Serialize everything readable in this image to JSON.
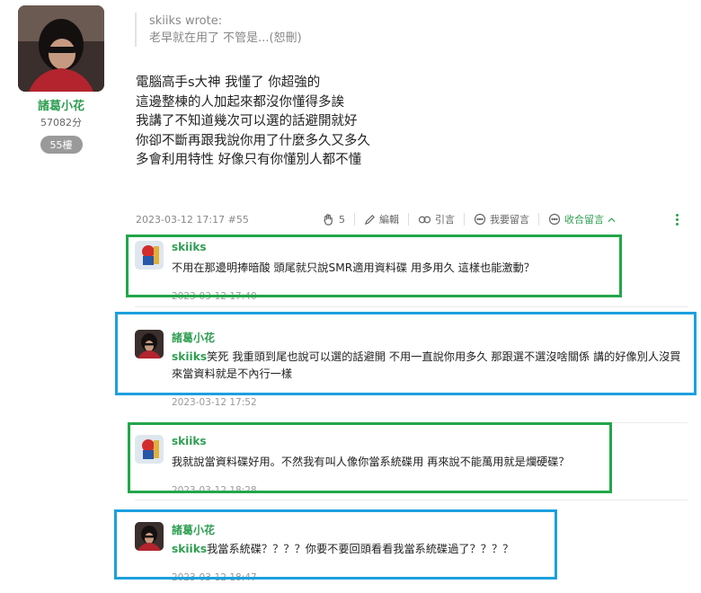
{
  "post": {
    "author": {
      "name": "諸葛小花",
      "points": "57082分",
      "floor": "55樓"
    },
    "quote": {
      "header": "skiiks wrote:",
      "text": "老早就在用了 不管是...(恕刪)"
    },
    "body_lines": [
      "電腦高手s大神 我懂了 你超強的",
      "這邊整棟的人加起來都沒你懂得多誒",
      "我講了不知道幾次可以選的話避開就好",
      "你卻不斷再跟我說你用了什麼多久又多久",
      "多會利用特性 好像只有你懂別人都不懂"
    ],
    "meta": "2023-03-12 17:17 #55",
    "actions": {
      "like_count": "5",
      "edit": "編輯",
      "quote": "引言",
      "reply": "我要留言",
      "collapse": "收合留言"
    }
  },
  "comments": [
    {
      "name": "skiiks",
      "mention": "",
      "text": "不用在那邊明捧暗酸 頭尾就只說SMR適用資料碟 用多用久 這樣也能激動？",
      "time": "2023-03-12 17:40"
    },
    {
      "name": "諸葛小花",
      "mention": "skiiks",
      "text": "笑死 我重頭到尾也說可以選的話避開 不用一直說你用多久 那跟選不選沒啥關係 講的好像別人沒買來當資料就是不內行一樣",
      "time": "2023-03-12 17:52"
    },
    {
      "name": "skiiks",
      "mention": "",
      "text": "我就說當資料碟好用。不然我有叫人像你當系統碟用 再來說不能萬用就是爛硬碟？",
      "time": "2023-03-12 18:28"
    },
    {
      "name": "諸葛小花",
      "mention": "skiiks",
      "text": "我當系統碟？？？？你要不要回頭看看我當系統碟過了？？？？",
      "time": "2023-03-12 18:47"
    }
  ],
  "colors": {
    "brand_green": "#2e9e51",
    "highlight_green": "#22a64a",
    "highlight_blue": "#1ca0de"
  },
  "icons": [
    "clap-icon",
    "pencil-icon",
    "quote-icon",
    "chat-bubble-icon",
    "collapse-chat-icon",
    "chevron-up-icon",
    "more-vertical-icon"
  ]
}
